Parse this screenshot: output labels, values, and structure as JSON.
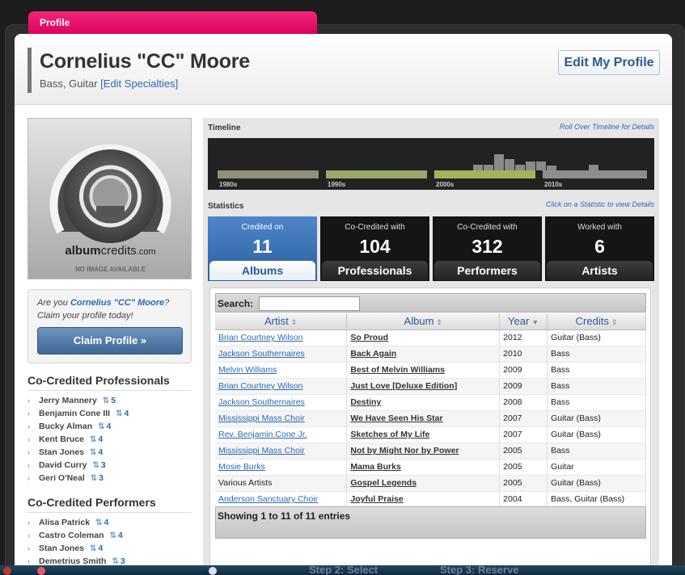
{
  "tab": {
    "label": "Profile"
  },
  "header": {
    "name": "Cornelius \"CC\" Moore",
    "specialties": "Bass, Guitar",
    "edit_specialties": "[Edit Specialties]",
    "edit_profile": "Edit My Profile"
  },
  "image_box": {
    "logo_album": "album",
    "logo_credits": "credits",
    "logo_com": ".com",
    "no_image": "NO IMAGE AVAILABLE"
  },
  "claim": {
    "question_prefix": "Are you ",
    "question_name": "Cornelius \"CC\" Moore",
    "question_suffix": "?",
    "subtitle": "Claim your profile today!",
    "button": "Claim Profile »"
  },
  "professionals": {
    "title": "Co-Credited Professionals",
    "items": [
      {
        "name": "Jerry Mannery",
        "count": "5"
      },
      {
        "name": "Benjamin Cone III",
        "count": "4"
      },
      {
        "name": "Bucky Alman",
        "count": "4"
      },
      {
        "name": "Kent Bruce",
        "count": "4"
      },
      {
        "name": "Stan Jones",
        "count": "4"
      },
      {
        "name": "David Curry",
        "count": "3"
      },
      {
        "name": "Geri O'Neal",
        "count": "3"
      }
    ]
  },
  "performers": {
    "title": "Co-Credited Performers",
    "items": [
      {
        "name": "Alisa Patrick",
        "count": "4"
      },
      {
        "name": "Castro Coleman",
        "count": "4"
      },
      {
        "name": "Stan Jones",
        "count": "4"
      },
      {
        "name": "Demetrius Smith",
        "count": "3"
      }
    ]
  },
  "timeline": {
    "label": "Timeline",
    "hint": "Roll Over Timeline for Details",
    "decades": [
      {
        "label": "1980s",
        "color": "#8f8f7a"
      },
      {
        "label": "1990s",
        "color": "#9aa86a"
      },
      {
        "label": "2000s",
        "color": "#a3b45c"
      },
      {
        "label": "2010s",
        "color": "#8d8d8d"
      }
    ],
    "bar_levels": [
      0.22,
      0.22,
      0.68,
      0.45,
      0.22,
      0.35,
      0.35,
      0.2,
      0,
      0,
      0,
      0.22
    ]
  },
  "statistics": {
    "label": "Statistics",
    "hint": "Click on a Statistic to view Details",
    "items": [
      {
        "caption": "Credited on",
        "number": "11",
        "label": "Albums",
        "active": true
      },
      {
        "caption": "Co-Credited with",
        "number": "104",
        "label": "Professionals",
        "active": false
      },
      {
        "caption": "Co-Credited with",
        "number": "312",
        "label": "Performers",
        "active": false
      },
      {
        "caption": "Worked with",
        "number": "6",
        "label": "Artists",
        "active": false
      }
    ]
  },
  "table": {
    "search_label": "Search:",
    "search_value": "",
    "columns": [
      "Artist",
      "Album",
      "Year",
      "Credits"
    ],
    "rows": [
      {
        "artist": "Brian Courtney Wilson",
        "album": "So Proud",
        "year": "2012",
        "credits": "Guitar (Bass)",
        "link": true
      },
      {
        "artist": "Jackson Southernaires",
        "album": "Back Again",
        "year": "2010",
        "credits": "Bass",
        "link": true
      },
      {
        "artist": "Melvin Williams",
        "album": "Best of Melvin Williams",
        "year": "2009",
        "credits": "Bass",
        "link": true
      },
      {
        "artist": "Brian Courtney Wilson",
        "album": "Just Love [Deluxe Edition]",
        "year": "2009",
        "credits": "Bass",
        "link": true
      },
      {
        "artist": "Jackson Southernaires",
        "album": "Destiny",
        "year": "2008",
        "credits": "Bass",
        "link": true
      },
      {
        "artist": "Mississippi Mass Choir",
        "album": "We Have Seen His Star",
        "year": "2007",
        "credits": "Guitar (Bass)",
        "link": true
      },
      {
        "artist": "Rev. Benjamin Cone Jr.",
        "album": "Sketches of My Life",
        "year": "2007",
        "credits": "Guitar (Bass)",
        "link": true
      },
      {
        "artist": "Mississippi Mass Choir",
        "album": "Not by Might Nor by Power",
        "year": "2005",
        "credits": "Bass",
        "link": true
      },
      {
        "artist": "Mosie Burks",
        "album": "Mama Burks",
        "year": "2005",
        "credits": "Guitar",
        "link": true
      },
      {
        "artist": "Various Artists",
        "album": "Gospel Legends",
        "year": "2005",
        "credits": "Guitar (Bass)",
        "link": false
      },
      {
        "artist": "Anderson Sanctuary Choir",
        "album": "Joyful Praise",
        "year": "2004",
        "credits": "Bass, Guitar (Bass)",
        "link": true
      }
    ],
    "footer": "Showing 1 to 11 of 11 entries"
  },
  "dock": {
    "items": [
      "Step 2: Select",
      "Step 3: Reserve"
    ]
  }
}
